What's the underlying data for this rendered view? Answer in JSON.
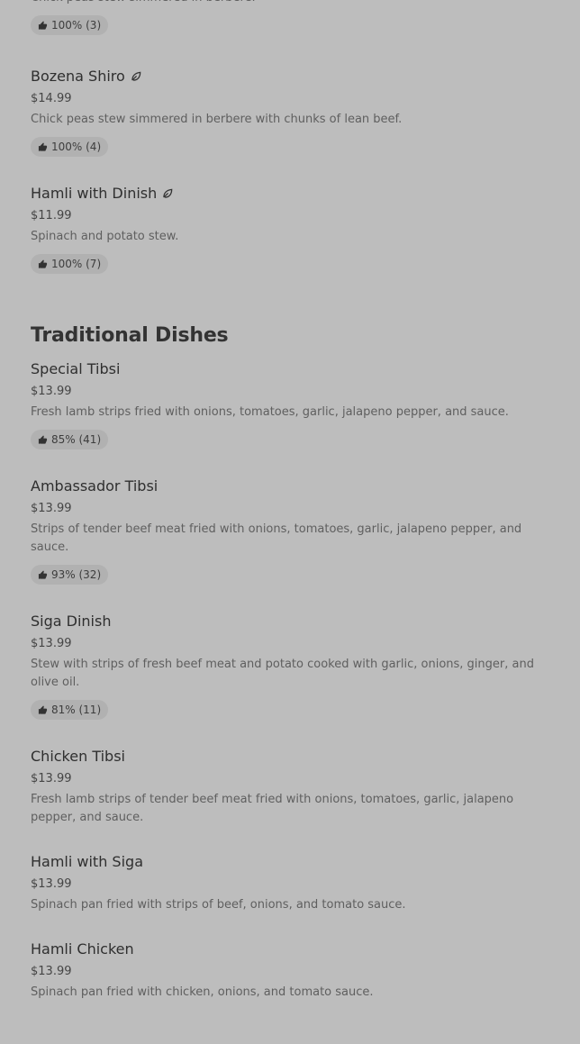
{
  "items_top": [
    {
      "desc": "Chick peas stew simmered in berbere.",
      "rating": "100% (3)"
    },
    {
      "name": "Bozena Shiro",
      "vegetarian": true,
      "price": "$14.99",
      "desc": "Chick peas stew simmered in berbere with chunks of lean beef.",
      "rating": "100% (4)"
    },
    {
      "name": "Hamli with Dinish",
      "vegetarian": true,
      "price": "$11.99",
      "desc": "Spinach and potato stew.",
      "rating": "100% (7)"
    }
  ],
  "section": {
    "title": "Traditional Dishes"
  },
  "items": [
    {
      "name": "Special Tibsi",
      "price": "$13.99",
      "desc": "Fresh lamb strips fried with onions, tomatoes, garlic, jalapeno pepper, and sauce.",
      "rating": "85% (41)"
    },
    {
      "name": "Ambassador Tibsi",
      "price": "$13.99",
      "desc": "Strips of tender beef meat fried with onions, tomatoes, garlic, jalapeno pepper, and sauce.",
      "rating": "93% (32)"
    },
    {
      "name": "Siga Dinish",
      "price": "$13.99",
      "desc": "Stew with strips of fresh beef meat and potato cooked with garlic, onions, ginger, and olive oil.",
      "rating": "81% (11)"
    },
    {
      "name": "Chicken Tibsi",
      "price": "$13.99",
      "desc": "Fresh lamb strips of tender beef meat fried with onions, tomatoes, garlic, jalapeno pepper, and sauce."
    },
    {
      "name": "Hamli with Siga",
      "price": "$13.99",
      "desc": "Spinach pan fried with strips of beef, onions, and tomato sauce."
    },
    {
      "name": "Hamli Chicken",
      "price": "$13.99",
      "desc": "Spinach pan fried with chicken, onions, and tomato sauce."
    }
  ],
  "icons": {
    "thumbs_up": "thumbs-up-icon",
    "vegetarian": "leaf-icon"
  }
}
